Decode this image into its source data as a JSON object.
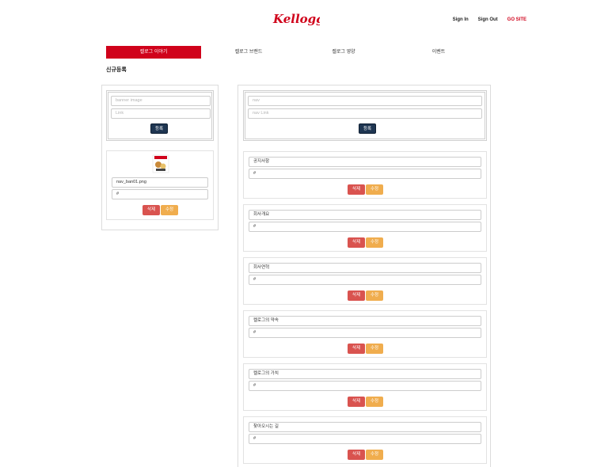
{
  "brand": {
    "logo_text": "Kellogg's",
    "color": "#d0021b"
  },
  "topnav": {
    "sign_in": "Sign In",
    "sign_out": "Sign Out",
    "go_site": "GO SITE"
  },
  "tabs": [
    {
      "label": "켈로그 이야기",
      "active": true
    },
    {
      "label": "켈로그 브랜드",
      "active": false
    },
    {
      "label": "켈로그 영양",
      "active": false
    },
    {
      "label": "이벤트",
      "active": false
    }
  ],
  "section_title": "신규등록",
  "banner_form": {
    "image_placeholder": "banner image",
    "link_placeholder": "Link",
    "submit_label": "등록"
  },
  "banner_items": [
    {
      "image_value": "nav_ban01.png",
      "link_value": "#",
      "delete_label": "삭제",
      "edit_label": "수정"
    }
  ],
  "nav_form": {
    "nav_placeholder": "nav",
    "link_placeholder": "nav Link",
    "submit_label": "등록"
  },
  "nav_items": [
    {
      "name": "공지사항",
      "link": "#",
      "delete_label": "삭제",
      "edit_label": "수정"
    },
    {
      "name": "회사개요",
      "link": "#",
      "delete_label": "삭제",
      "edit_label": "수정"
    },
    {
      "name": "회사연혁",
      "link": "#",
      "delete_label": "삭제",
      "edit_label": "수정"
    },
    {
      "name": "켈로그의 약속",
      "link": "#",
      "delete_label": "삭제",
      "edit_label": "수정"
    },
    {
      "name": "켈로그의 가치",
      "link": "#",
      "delete_label": "삭제",
      "edit_label": "수정"
    },
    {
      "name": "찾아오시는 길",
      "link": "#",
      "delete_label": "삭제",
      "edit_label": "수정"
    }
  ],
  "colors": {
    "active_tab": "#d0021b",
    "delete_button": "#d9534f",
    "edit_button": "#f0ad4e",
    "submit_button": "#1f3652"
  }
}
